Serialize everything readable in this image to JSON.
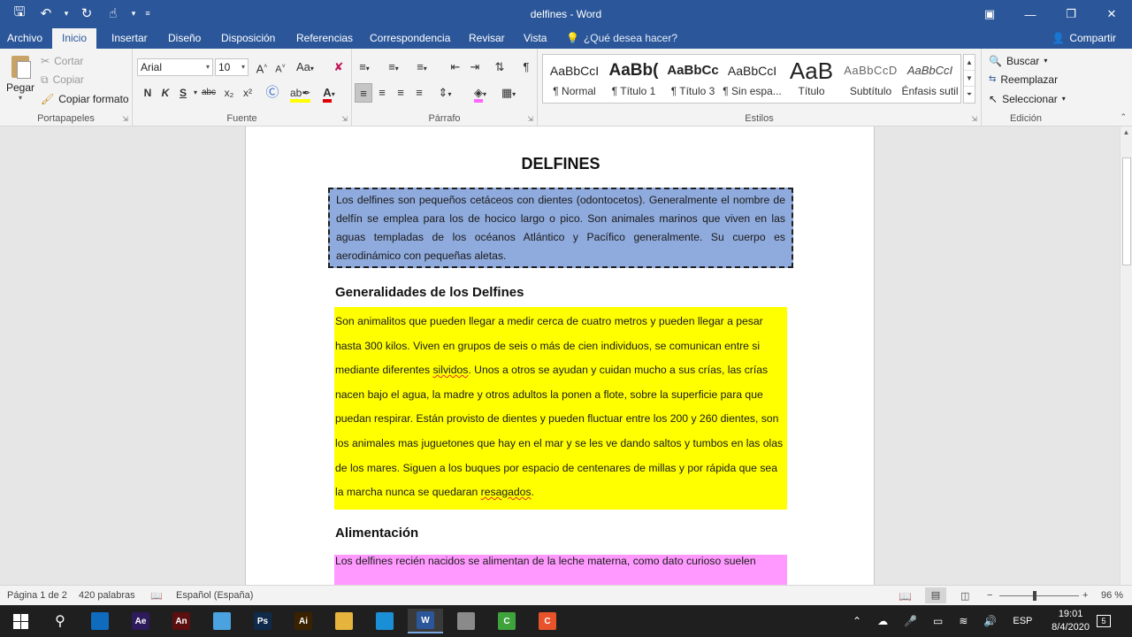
{
  "window": {
    "title": "delfines - Word"
  },
  "tabs": [
    {
      "label": "Archivo"
    },
    {
      "label": "Inicio"
    },
    {
      "label": "Insertar"
    },
    {
      "label": "Diseño"
    },
    {
      "label": "Disposición"
    },
    {
      "label": "Referencias"
    },
    {
      "label": "Correspondencia"
    },
    {
      "label": "Revisar"
    },
    {
      "label": "Vista"
    }
  ],
  "tell_me": "¿Qué desea hacer?",
  "share_label": "Compartir",
  "clipboard": {
    "paste": "Pegar",
    "cut": "Cortar",
    "copy": "Copiar",
    "format_painter": "Copiar formato",
    "label": "Portapapeles"
  },
  "font": {
    "name": "Arial",
    "size": "10",
    "case_label": "Aa",
    "label": "Fuente",
    "bold": "N",
    "italic": "K",
    "underline": "S",
    "strike": "abc",
    "subscript": "x₂",
    "superscript": "x²"
  },
  "paragraph": {
    "label": "Párrafo"
  },
  "styles": {
    "label": "Estilos",
    "items": [
      {
        "sample": "AaBbCcI",
        "name": "¶ Normal"
      },
      {
        "sample": "AaBb(",
        "name": "¶ Título 1"
      },
      {
        "sample": "AaBbCc",
        "name": "¶ Título 3"
      },
      {
        "sample": "AaBbCcI",
        "name": "¶ Sin espa..."
      },
      {
        "sample": "AaB",
        "name": "Título"
      },
      {
        "sample": "AaBbCcD",
        "name": "Subtítulo"
      },
      {
        "sample": "AaBbCcI",
        "name": "Énfasis sutil"
      }
    ]
  },
  "editing": {
    "find": "Buscar",
    "replace": "Reemplazar",
    "select": "Seleccionar",
    "label": "Edición"
  },
  "document": {
    "title": "DELFINES",
    "intro": "Los delfines son pequeños cetáceos con dientes (odontocetos). Generalmente el nombre de delfín se emplea para los de hocico largo o pico. Son animales marinos que viven en las aguas templadas de los océanos Atlántico y Pacífico generalmente. Su cuerpo es aerodinámico con pequeñas aletas.",
    "h_generalidades": "Generalidades de los Delfines",
    "gen_text_1": "Son animalitos que pueden llegar a medir cerca de cuatro metros y pueden llegar a pesar hasta 300 kilos. Viven en grupos de seis o más de cien individuos, se comunican entre si mediante diferentes ",
    "gen_word_1": "silvidos",
    "gen_text_2": ". Unos a otros se ayudan y cuidan mucho a sus crías, las crías nacen bajo el agua, la madre y otros adultos la ponen a flote, sobre la superficie para que puedan respirar. Están provisto de dientes y pueden fluctuar entre los 200 y 260 dientes, son los animales mas juguetones que hay en el mar y se les ve dando saltos y tumbos en las olas de los mares. Siguen a los buques por espacio de centenares de millas y por rápida que sea la marcha nunca se quedaran ",
    "gen_word_2": "resagados",
    "gen_text_3": ".",
    "h_alimentacion": "Alimentación",
    "alim_text": "Los delfines recién nacidos se alimentan de la leche materna, como dato curioso suelen"
  },
  "status": {
    "page": "Página 1 de 2",
    "words": "420 palabras",
    "language": "Español (España)",
    "zoom": "96 %",
    "zoom_level": 0.96
  },
  "taskbar": {
    "lang": "ESP",
    "time": "19:01",
    "date": "8/4/2020",
    "notifications": "5",
    "apps": [
      {
        "name": "Outlook",
        "letter": "",
        "color": "#0f6cbd"
      },
      {
        "name": "After Effects",
        "letter": "Ae",
        "color": "#2d1b5c"
      },
      {
        "name": "Animate",
        "letter": "An",
        "color": "#5c0f0f"
      },
      {
        "name": "Browser",
        "letter": "",
        "color": "#4aa3df"
      },
      {
        "name": "Photoshop",
        "letter": "Ps",
        "color": "#0f2a4a"
      },
      {
        "name": "Illustrator",
        "letter": "Ai",
        "color": "#3a2200"
      },
      {
        "name": "File Explorer",
        "letter": "",
        "color": "#e6b33c"
      },
      {
        "name": "Edge",
        "letter": "",
        "color": "#1b8fd6"
      },
      {
        "name": "Word",
        "letter": "W",
        "color": "#2b579a"
      },
      {
        "name": "Paint",
        "letter": "",
        "color": "#8a8a8a"
      },
      {
        "name": "Camtasia",
        "letter": "C",
        "color": "#3fa33c"
      },
      {
        "name": "Camtasia Recorder",
        "letter": "C",
        "color": "#e8532b"
      }
    ]
  }
}
